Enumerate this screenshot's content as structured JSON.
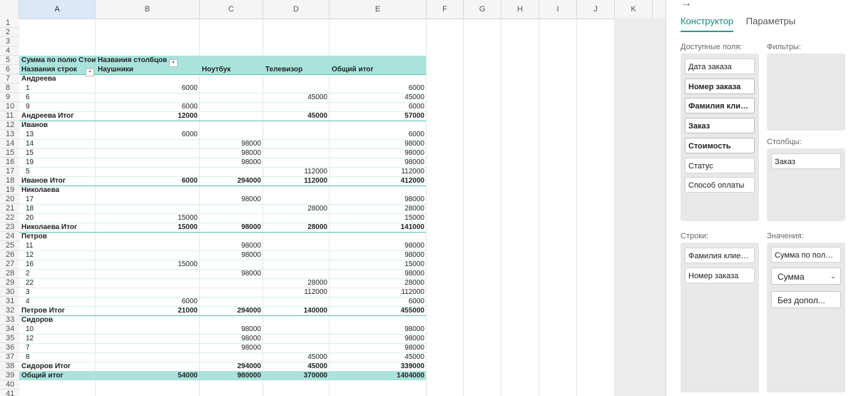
{
  "columns": [
    "A",
    "B",
    "C",
    "D",
    "E",
    "F",
    "G",
    "H",
    "I",
    "J",
    "K"
  ],
  "row_numbers": [
    "1",
    "2",
    "3",
    "4",
    "5",
    "6",
    "7",
    "8",
    "9",
    "10",
    "11",
    "12",
    "13",
    "14",
    "15",
    "16",
    "17",
    "18",
    "19",
    "20",
    "21",
    "22",
    "23",
    "24",
    "25",
    "26",
    "27",
    "28",
    "29",
    "30",
    "31",
    "32",
    "33",
    "34",
    "35",
    "36",
    "37",
    "38",
    "39",
    "40",
    "41"
  ],
  "pivot": {
    "header1": {
      "a": "Сумма по полю Стоим",
      "b": "Названия столбцов"
    },
    "header2": {
      "a": "Названия строк",
      "b": "Наушники",
      "c": "Ноутбук",
      "d": "Телевизор",
      "e": "Общий итог"
    },
    "rows": [
      {
        "t": "g",
        "a": "Андреева",
        "b": "",
        "c": "",
        "d": "",
        "e": ""
      },
      {
        "t": "d",
        "a": "1",
        "b": "6000",
        "c": "",
        "d": "",
        "e": "6000"
      },
      {
        "t": "d",
        "a": "6",
        "b": "",
        "c": "",
        "d": "45000",
        "e": "45000"
      },
      {
        "t": "d",
        "a": "9",
        "b": "6000",
        "c": "",
        "d": "",
        "e": "6000"
      },
      {
        "t": "s",
        "a": "Андреева Итог",
        "b": "12000",
        "c": "",
        "d": "45000",
        "e": "57000"
      },
      {
        "t": "g",
        "a": "Иванов",
        "b": "",
        "c": "",
        "d": "",
        "e": ""
      },
      {
        "t": "d",
        "a": "13",
        "b": "6000",
        "c": "",
        "d": "",
        "e": "6000"
      },
      {
        "t": "d",
        "a": "14",
        "b": "",
        "c": "98000",
        "d": "",
        "e": "98000"
      },
      {
        "t": "d",
        "a": "15",
        "b": "",
        "c": "98000",
        "d": "",
        "e": "98000"
      },
      {
        "t": "d",
        "a": "19",
        "b": "",
        "c": "98000",
        "d": "",
        "e": "98000"
      },
      {
        "t": "d",
        "a": "5",
        "b": "",
        "c": "",
        "d": "112000",
        "e": "112000"
      },
      {
        "t": "s",
        "a": "Иванов Итог",
        "b": "6000",
        "c": "294000",
        "d": "112000",
        "e": "412000"
      },
      {
        "t": "g",
        "a": "Николаева",
        "b": "",
        "c": "",
        "d": "",
        "e": ""
      },
      {
        "t": "d",
        "a": "17",
        "b": "",
        "c": "98000",
        "d": "",
        "e": "98000"
      },
      {
        "t": "d",
        "a": "18",
        "b": "",
        "c": "",
        "d": "28000",
        "e": "28000"
      },
      {
        "t": "d",
        "a": "20",
        "b": "15000",
        "c": "",
        "d": "",
        "e": "15000"
      },
      {
        "t": "s",
        "a": "Николаева Итог",
        "b": "15000",
        "c": "98000",
        "d": "28000",
        "e": "141000"
      },
      {
        "t": "g",
        "a": "Петров",
        "b": "",
        "c": "",
        "d": "",
        "e": ""
      },
      {
        "t": "d",
        "a": "11",
        "b": "",
        "c": "98000",
        "d": "",
        "e": "98000"
      },
      {
        "t": "d",
        "a": "12",
        "b": "",
        "c": "98000",
        "d": "",
        "e": "98000"
      },
      {
        "t": "d",
        "a": "16",
        "b": "15000",
        "c": "",
        "d": "",
        "e": "15000"
      },
      {
        "t": "d",
        "a": "2",
        "b": "",
        "c": "98000",
        "d": "",
        "e": "98000"
      },
      {
        "t": "d",
        "a": "22",
        "b": "",
        "c": "",
        "d": "28000",
        "e": "28000"
      },
      {
        "t": "d",
        "a": "3",
        "b": "",
        "c": "",
        "d": "112000",
        "e": "112000"
      },
      {
        "t": "d",
        "a": "4",
        "b": "6000",
        "c": "",
        "d": "",
        "e": "6000"
      },
      {
        "t": "s",
        "a": "Петров Итог",
        "b": "21000",
        "c": "294000",
        "d": "140000",
        "e": "455000"
      },
      {
        "t": "g",
        "a": "Сидоров",
        "b": "",
        "c": "",
        "d": "",
        "e": ""
      },
      {
        "t": "d",
        "a": "10",
        "b": "",
        "c": "98000",
        "d": "",
        "e": "98000"
      },
      {
        "t": "d",
        "a": "12",
        "b": "",
        "c": "98000",
        "d": "",
        "e": "98000"
      },
      {
        "t": "d",
        "a": "7",
        "b": "",
        "c": "98000",
        "d": "",
        "e": "98000"
      },
      {
        "t": "d",
        "a": "8",
        "b": "",
        "c": "",
        "d": "45000",
        "e": "45000"
      },
      {
        "t": "s",
        "a": "Сидоров Итог",
        "b": "",
        "c": "294000",
        "d": "45000",
        "e": "339000"
      },
      {
        "t": "t",
        "a": "Общий итог",
        "b": "54000",
        "c": "980000",
        "d": "370000",
        "e": "1404000"
      }
    ]
  },
  "panel": {
    "back_arrow": "→",
    "tab_constructor": "Конструктор",
    "tab_params": "Параметры",
    "available_label": "Доступные поля:",
    "filters_label": "Фильтры:",
    "columns_label": "Столбцы:",
    "rows_label": "Строки:",
    "values_label": "Значения:",
    "available_fields": [
      {
        "label": "Дата заказа",
        "bold": false
      },
      {
        "label": "Номер заказа",
        "bold": true
      },
      {
        "label": "Фамилия клие...",
        "bold": true
      },
      {
        "label": "Заказ",
        "bold": true
      },
      {
        "label": "Стоимость",
        "bold": true
      },
      {
        "label": "Статус",
        "bold": false
      },
      {
        "label": "Способ оплаты",
        "bold": false
      }
    ],
    "column_fields": [
      "Заказ"
    ],
    "row_fields": [
      "Фамилия клиента",
      "Номер заказа"
    ],
    "value_field": "Сумма по полю ...",
    "value_agg": "Сумма",
    "value_extra": "Без допол..."
  },
  "colors": {
    "accent": "#1aa08e",
    "pivot_header": "#a9e3dc",
    "selected_col": "#dbe8f8"
  }
}
